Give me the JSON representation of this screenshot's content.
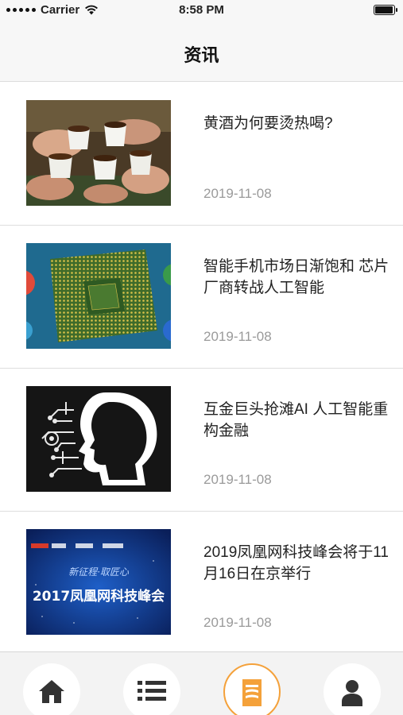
{
  "status_bar": {
    "carrier": "Carrier",
    "time": "8:58 PM",
    "battery_level": 1.0
  },
  "nav": {
    "title": "资讯"
  },
  "news": [
    {
      "title": "黄酒为何要烫热喝?",
      "date": "2019-11-08",
      "thumb_icon": "tea-cups-photo"
    },
    {
      "title": "智能手机市场日渐饱和 芯片厂商转战人工智能",
      "date": "2019-11-08",
      "thumb_icon": "cpu-chip-photo"
    },
    {
      "title": "互金巨头抢滩AI 人工智能重构金融",
      "date": "2019-11-08",
      "thumb_icon": "ai-head-photo"
    },
    {
      "title": "2019凤凰网科技峰会将于11月16日在京举行",
      "date": "2019-11-08",
      "thumb_icon": "summit-banner-photo"
    }
  ],
  "banner": {
    "slogan": "新征程·取匠心",
    "headline": "2017凤凰网科技峰会"
  },
  "tabs": [
    {
      "icon": "home-icon",
      "active": false
    },
    {
      "icon": "list-icon",
      "active": false
    },
    {
      "icon": "news-icon",
      "active": true
    },
    {
      "icon": "profile-icon",
      "active": false
    }
  ],
  "colors": {
    "accent": "#f4a13a",
    "icon_dark": "#333333",
    "date_gray": "#9a9a9a"
  }
}
